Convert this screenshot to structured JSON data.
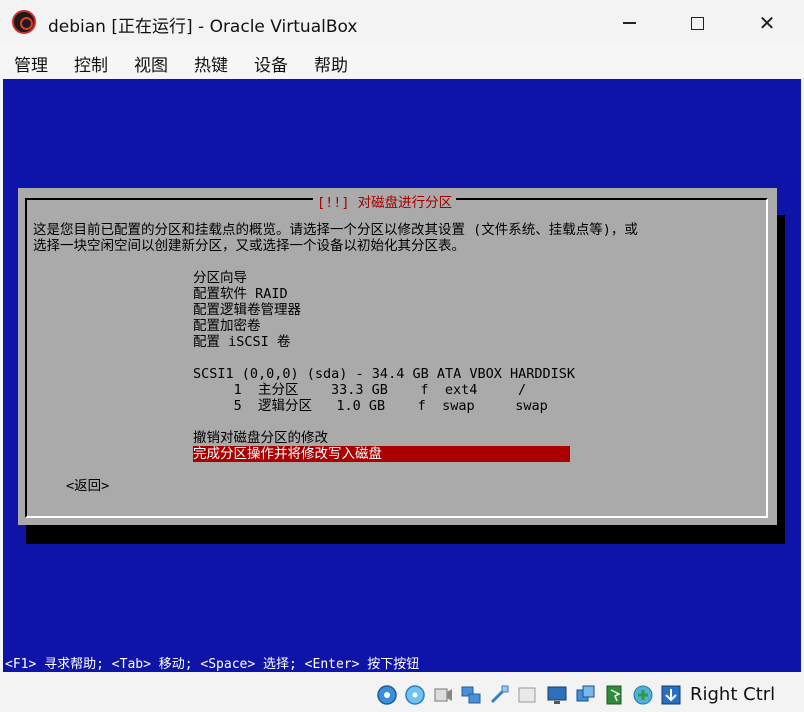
{
  "window": {
    "title": "debian [正在运行] - Oracle VirtualBox",
    "controls": {
      "minimize": "",
      "maximize": "",
      "close": "✕"
    }
  },
  "menu": [
    "管理",
    "控制",
    "视图",
    "热键",
    "设备",
    "帮助"
  ],
  "installer": {
    "title": "[!!] 对磁盘进行分区",
    "intro_line1": "这是您目前已配置的分区和挂载点的概览。请选择一个分区以修改其设置 (文件系统、挂载点等)，或",
    "intro_line2": "选择一块空闲空间以创建新分区，又或选择一个设备以初始化其分区表。",
    "options": [
      "分区向导",
      "配置软件 RAID",
      "配置逻辑卷管理器",
      "配置加密卷",
      "配置 iSCSI 卷"
    ],
    "disk": {
      "label": "SCSI1 (0,0,0) (sda) - 34.4 GB ATA VBOX HARDDISK",
      "partitions": [
        "     1  主分区    33.3 GB    f  ext4     /",
        "     5  逻辑分区   1.0 GB    f  swap     swap"
      ]
    },
    "actions": [
      "撤销对磁盘分区的修改",
      "完成分区操作并将修改写入磁盘"
    ],
    "back": "<返回>"
  },
  "help_line": "<F1> 寻求帮助; <Tab> 移动; <Space> 选择; <Enter> 按下按钮",
  "statusbar": {
    "icons": [
      "hard-disk-icon",
      "optical-drive-icon",
      "audio-icon",
      "network-icon",
      "usb-icon",
      "shared-folders-icon",
      "display-icon",
      "video-capture-icon",
      "mouse-integration-icon",
      "cpu-icon",
      "keyboard-icon"
    ],
    "host_key": "Right Ctrl"
  },
  "colors": {
    "vm_background": "#0f14a9",
    "dialog_bg": "#aaaaaa",
    "title_red": "#a40000",
    "selection": "#aa0000"
  }
}
